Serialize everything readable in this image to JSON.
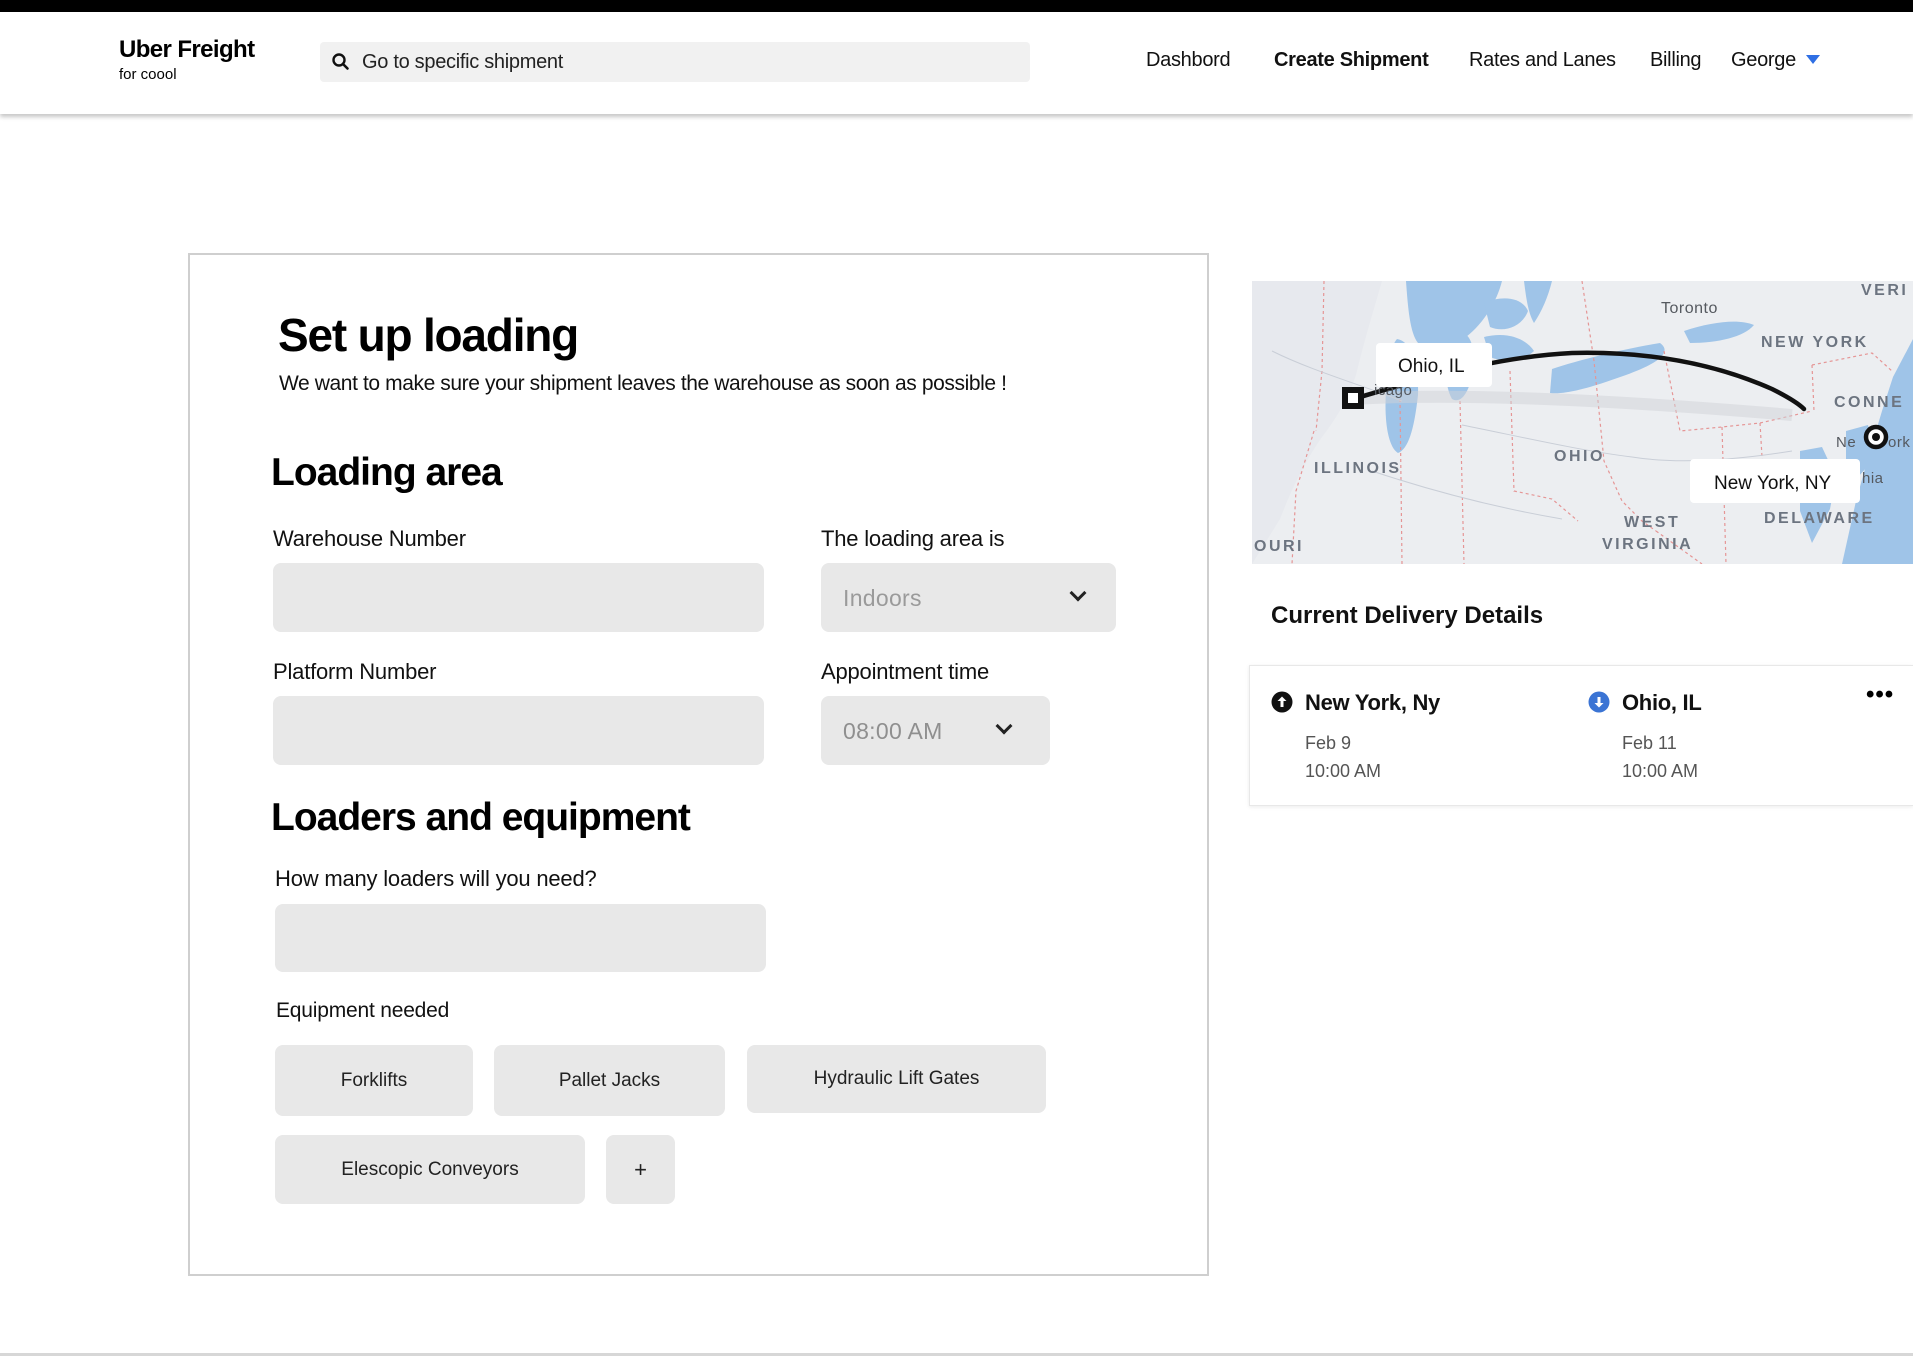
{
  "brand": {
    "title": "Uber Freight",
    "subtitle": "for coool"
  },
  "search": {
    "placeholder": "Go to specific shipment",
    "icon": "search-icon"
  },
  "nav": {
    "items": [
      {
        "label": "Dashbord",
        "active": false
      },
      {
        "label": "Create Shipment",
        "active": true
      },
      {
        "label": "Rates and Lanes",
        "active": false
      },
      {
        "label": "Billing",
        "active": false
      }
    ],
    "user": "George",
    "accent": "#2f6fe4"
  },
  "form": {
    "title": "Set up loading",
    "subtitle": "We want to make sure your shipment leaves the warehouse as soon as possible !",
    "loading_area": {
      "heading": "Loading area",
      "warehouse_label": "Warehouse Number",
      "warehouse_value": "",
      "area_label": "The loading area is",
      "area_value": "Indoors",
      "platform_label": "Platform Number",
      "platform_value": "",
      "time_label": "Appointment time",
      "time_value": "08:00 AM"
    },
    "loaders": {
      "heading": "Loaders and equipment",
      "count_label": "How many loaders will you need?",
      "count_value": "",
      "equipment_label": "Equipment needed",
      "equipment": [
        "Forklifts",
        "Pallet Jacks",
        "Hydraulic Lift Gates",
        "Elescopic Conveyors"
      ],
      "add_label": "+"
    }
  },
  "map": {
    "labels": [
      "VERI",
      "Toronto",
      "NEW YORK",
      "CONNE",
      "ILLINOIS",
      "OHIO",
      "WEST",
      "VIRGINIA",
      "DELAWARE",
      "OURI",
      "hia",
      "Ne",
      "ork",
      "icago"
    ],
    "origin_label": "Ohio, IL",
    "destination_label": "New York, NY"
  },
  "details": {
    "title": "Current Delivery Details",
    "origin": {
      "name": "New York, Ny",
      "date": "Feb 9",
      "time": "10:00 AM",
      "icon": "arrow-up-circle-icon"
    },
    "destination": {
      "name": "Ohio, IL",
      "date": "Feb 11",
      "time": "10:00 AM",
      "icon": "arrow-down-circle-icon",
      "color": "#3b74d4"
    },
    "more": "•••"
  }
}
